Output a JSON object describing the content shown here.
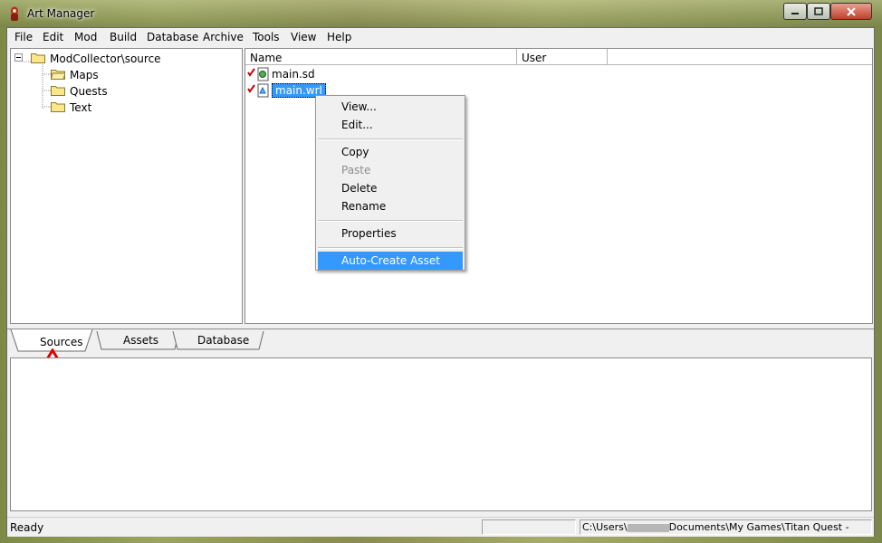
{
  "window": {
    "title": "Art Manager"
  },
  "menu": [
    "File",
    "Edit",
    "Mod",
    "Build",
    "Database",
    "Archive",
    "Tools",
    "View",
    "Help"
  ],
  "tree": {
    "root": "ModCollector\\source",
    "children": [
      "Maps",
      "Quests",
      "Text"
    ]
  },
  "list": {
    "columns": [
      "Name",
      "User"
    ],
    "rows": [
      {
        "name": "main.sd"
      },
      {
        "name": "main.wrl"
      }
    ]
  },
  "context_menu": {
    "items": [
      "View...",
      "Edit...",
      "Copy",
      "Paste",
      "Delete",
      "Rename",
      "Properties",
      "Auto-Create Asset"
    ]
  },
  "tabs": [
    "Sources",
    "Assets",
    "Database"
  ],
  "status": {
    "left": "Ready",
    "path": "C:\\Users\\",
    "path_rest": "Documents\\My Games\\Titan Quest -"
  },
  "colors": {
    "selection": "#3399ff",
    "arrow": "#e00000",
    "check": "#d00000"
  }
}
